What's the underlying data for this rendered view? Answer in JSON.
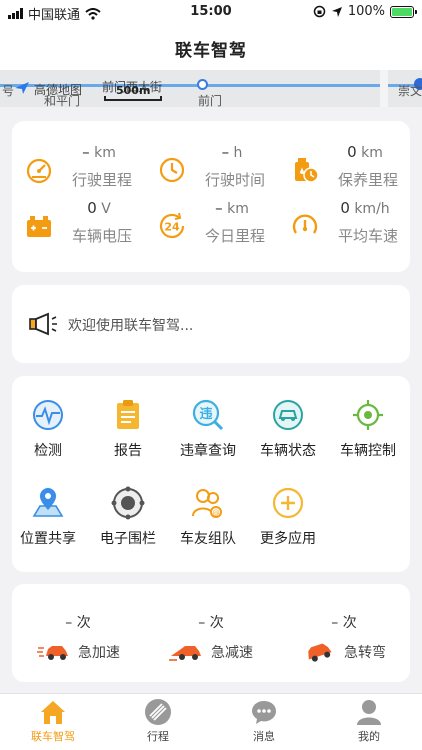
{
  "status_bar": {
    "carrier": "中国联通",
    "time": "15:00",
    "battery": "100%",
    "battery_level": 1.0
  },
  "nav": {
    "title": "联车智驾"
  },
  "map": {
    "labels": {
      "left_partial": "号",
      "logo": "高德地图",
      "street": "前门西大街",
      "scale": "500m",
      "station": "前门",
      "area_left": "和平门",
      "area_right": "崇文"
    }
  },
  "stats": [
    {
      "icon": "speedometer-icon",
      "value": "–",
      "unit": "km",
      "label": "行驶里程"
    },
    {
      "icon": "clock-icon",
      "value": "–",
      "unit": "h",
      "label": "行驶时间"
    },
    {
      "icon": "oil-maintenance-icon",
      "value": "0",
      "unit": "km",
      "label": "保养里程"
    },
    {
      "icon": "battery-icon",
      "value": "0",
      "unit": "V",
      "label": "车辆电压"
    },
    {
      "icon": "24h-icon",
      "value": "–",
      "unit": "km",
      "label": "今日里程"
    },
    {
      "icon": "gauge-icon",
      "value": "0",
      "unit": "km/h",
      "label": "平均车速"
    }
  ],
  "notice": {
    "icon": "megaphone-icon",
    "text": "欢迎使用联车智驾..."
  },
  "apps": [
    {
      "icon": "detection-icon",
      "label": "检测"
    },
    {
      "icon": "report-icon",
      "label": "报告"
    },
    {
      "icon": "violation-query-icon",
      "label": "违章查询"
    },
    {
      "icon": "vehicle-status-icon",
      "label": "车辆状态"
    },
    {
      "icon": "vehicle-control-icon",
      "label": "车辆控制"
    },
    {
      "icon": "location-share-icon",
      "label": "位置共享"
    },
    {
      "icon": "geofence-icon",
      "label": "电子围栏"
    },
    {
      "icon": "car-friends-icon",
      "label": "车友组队"
    },
    {
      "icon": "more-apps-icon",
      "label": "更多应用"
    }
  ],
  "behaviors": [
    {
      "icon": "rapid-accel-icon",
      "value": "– 次",
      "label": "急加速"
    },
    {
      "icon": "rapid-decel-icon",
      "value": "– 次",
      "label": "急减速"
    },
    {
      "icon": "sharp-turn-icon",
      "value": "– 次",
      "label": "急转弯"
    }
  ],
  "tabs": [
    {
      "icon": "home-icon",
      "label": "联车智驾",
      "active": true
    },
    {
      "icon": "trip-icon",
      "label": "行程",
      "active": false
    },
    {
      "icon": "message-icon",
      "label": "消息",
      "active": false
    },
    {
      "icon": "profile-icon",
      "label": "我的",
      "active": false
    }
  ],
  "colors": {
    "accent": "#f5a623",
    "icon_blue": "#3a8ee6",
    "icon_orange": "#f39c12",
    "alert_orange": "#f0612a"
  }
}
